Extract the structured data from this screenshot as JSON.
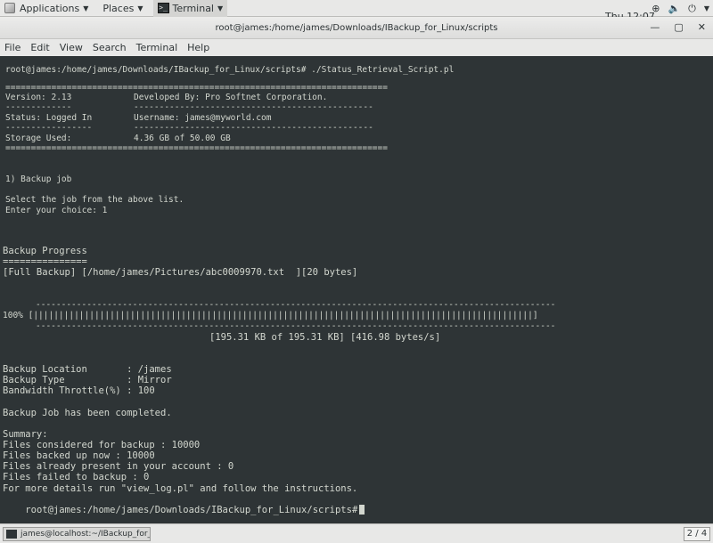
{
  "topbar": {
    "applications": "Applications",
    "places": "Places",
    "terminal": "Terminal",
    "clock": "Thu 12:07"
  },
  "window": {
    "title": "root@james:/home/james/Downloads/IBackup_for_Linux/scripts"
  },
  "menu": [
    "File",
    "Edit",
    "View",
    "Search",
    "Terminal",
    "Help"
  ],
  "terminal": {
    "cmd": "root@james:/home/james/Downloads/IBackup_for_Linux/scripts# ./Status_Retrieval_Script.pl",
    "sep_eq": "===========================================================================",
    "sep_dash_a": "-------------",
    "sep_dash_b": "-----------------------------------------------",
    "version": "Version: 2.13",
    "developed": "Developed By: Pro Softnet Corporation.",
    "status": "Status: Logged In",
    "username": "Username: james@myworld.com",
    "sep_dash_c": "-----------------",
    "storage_label": "Storage Used:",
    "storage_value": "4.36 GB of 50.00 GB",
    "job_item": "1) Backup job",
    "select_job": "Select the job from the above list.",
    "enter_choice": "Enter your choice: 1",
    "progress_title": "Backup Progress",
    "progress_underline": "===============",
    "full_backup": "[Full Backup] [/home/james/Pictures/abc0009970.txt  ][20 bytes]",
    "progress_dashes": "------------------------------------------------------------------------------------------------------",
    "progress_bar": "100% [||||||||||||||||||||||||||||||||||||||||||||||||||||||||||||||||||||||||||||||||||||||||||||||||||]",
    "progress_stats": "[195.31 KB of 195.31 KB] [416.98 bytes/s]",
    "location": "Backup Location       : /james",
    "type": "Backup Type           : Mirror",
    "throttle": "Bandwidth Throttle(%) : 100",
    "completed": "Backup Job has been completed.",
    "summary": "Summary:",
    "considered": "Files considered for backup : 10000",
    "backed_up": "Files backed up now : 10000",
    "present": "Files already present in your account : 0",
    "failed": "Files failed to backup : 0",
    "details": "For more details run \"view_log.pl\" and follow the instructions.",
    "prompt": "root@james:/home/james/Downloads/IBackup_for_Linux/scripts#"
  },
  "taskbar": {
    "task": "james@localhost:~/IBackup_for_Li...",
    "workspace": "2 / 4"
  }
}
